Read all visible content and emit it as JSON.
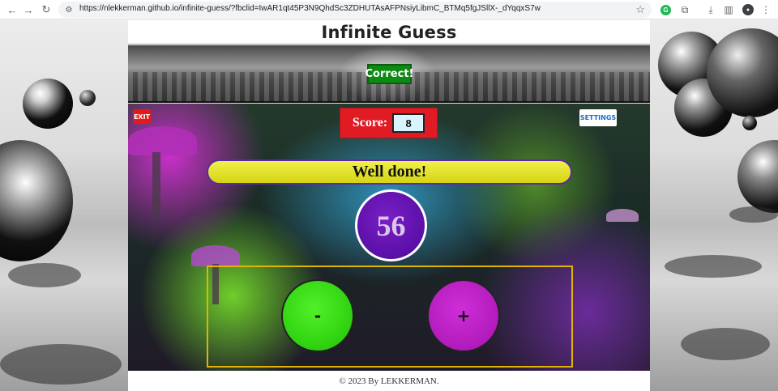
{
  "browser": {
    "url": "https://nlekkerman.github.io/infinite-guess/?fbclid=IwAR1qt45P3N9QhdSc3ZDHUTAsAFPNsiyLibmC_BTMq5fgJSllX-_dYqqxS7w",
    "icons": {
      "back": "back-arrow-icon",
      "forward": "forward-arrow-icon",
      "reload": "reload-icon",
      "site_info": "site-info-icon",
      "bookmark": "star-icon",
      "extension_green": "grammarly-icon",
      "extensions": "puzzle-icon",
      "downloads": "download-icon",
      "side_panel": "side-panel-icon",
      "profile": "avatar-icon",
      "menu": "kebab-menu-icon"
    }
  },
  "site": {
    "title": "Infinite Guess",
    "banner_status": "Correct!",
    "exit_label": "EXIT",
    "settings_label": "SETTINGS",
    "score_label": "Score:",
    "score_value": "8",
    "message": "Well done!",
    "current_number": "56",
    "minus_label": "-",
    "plus_label": "+",
    "footer": "© 2023 By LEKKERMAN."
  },
  "colors": {
    "correct_badge": "#0c8a12",
    "exit_button": "#e11b1b",
    "score_box": "#e01b24",
    "message_bar": "#e6e322",
    "number_circle": "#5a0fa6",
    "minus_button": "#2ed10e",
    "plus_button": "#b11bbb",
    "controls_border": "#e0b400"
  }
}
